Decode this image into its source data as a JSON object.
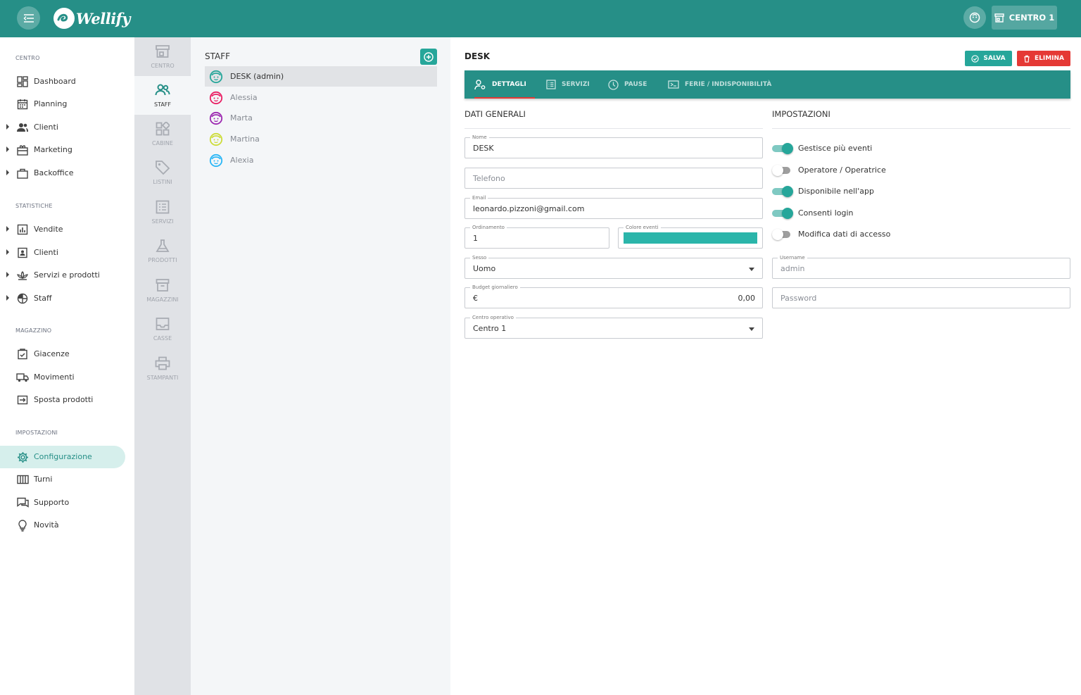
{
  "header": {
    "brand": "Wellify",
    "center_button_label": "CENTRO 1"
  },
  "sidebar": {
    "sections": [
      {
        "title": "CENTRO",
        "items": [
          {
            "label": "Dashboard",
            "icon": "dashboard-icon",
            "expandable": false
          },
          {
            "label": "Planning",
            "icon": "calendar-icon",
            "expandable": false
          },
          {
            "label": "Clienti",
            "icon": "users-icon",
            "expandable": true
          },
          {
            "label": "Marketing",
            "icon": "marketing-icon",
            "expandable": true
          },
          {
            "label": "Backoffice",
            "icon": "briefcase-icon",
            "expandable": true
          }
        ]
      },
      {
        "title": "STATISTICHE",
        "items": [
          {
            "label": "Vendite",
            "icon": "bar-chart-icon",
            "expandable": true
          },
          {
            "label": "Clienti",
            "icon": "contact-card-icon",
            "expandable": true
          },
          {
            "label": "Servizi e prodotti",
            "icon": "lotus-icon",
            "expandable": true
          },
          {
            "label": "Staff",
            "icon": "pie-chart-icon",
            "expandable": true
          }
        ]
      },
      {
        "title": "MAGAZZINO",
        "items": [
          {
            "label": "Giacenze",
            "icon": "clipboard-check-icon",
            "expandable": false
          },
          {
            "label": "Movimenti",
            "icon": "truck-icon",
            "expandable": false
          },
          {
            "label": "Sposta prodotti",
            "icon": "transfer-icon",
            "expandable": false
          }
        ]
      },
      {
        "title": "IMPOSTAZIONI",
        "items": [
          {
            "label": "Configurazione",
            "icon": "gear-icon",
            "expandable": false,
            "active": true
          },
          {
            "label": "Turni",
            "icon": "columns-icon",
            "expandable": false
          },
          {
            "label": "Supporto",
            "icon": "chat-icon",
            "expandable": false
          },
          {
            "label": "Novità",
            "icon": "lightbulb-icon",
            "expandable": false
          }
        ]
      }
    ]
  },
  "rail": {
    "items": [
      {
        "label": "CENTRO",
        "icon": "store-icon"
      },
      {
        "label": "STAFF",
        "icon": "staff-icon",
        "active": true
      },
      {
        "label": "CABINE",
        "icon": "grid-icon"
      },
      {
        "label": "LISTINI",
        "icon": "tag-icon"
      },
      {
        "label": "SERVIZI",
        "icon": "list-icon"
      },
      {
        "label": "PRODOTTI",
        "icon": "flask-icon"
      },
      {
        "label": "MAGAZZINI",
        "icon": "archive-icon"
      },
      {
        "label": "CASSE",
        "icon": "inbox-icon"
      },
      {
        "label": "STAMPANTI",
        "icon": "printer-icon"
      }
    ]
  },
  "staff_list": {
    "title": "STAFF",
    "items": [
      {
        "name": "DESK (admin)",
        "avatar_color": "#26a69a",
        "active": true
      },
      {
        "name": "Alessia",
        "avatar_color": "#e91e63"
      },
      {
        "name": "Marta",
        "avatar_color": "#9c27b0"
      },
      {
        "name": "Martina",
        "avatar_color": "#cddc39"
      },
      {
        "name": "Alexia",
        "avatar_color": "#29b6f6"
      }
    ]
  },
  "detail": {
    "title": "DESK",
    "save_label": "SALVA",
    "delete_label": "ELIMINA",
    "tabs": [
      {
        "label": "DETTAGLI",
        "icon": "user-settings-icon",
        "active": true
      },
      {
        "label": "SERVIZI",
        "icon": "list-icon"
      },
      {
        "label": "PAUSE",
        "icon": "clock-icon"
      },
      {
        "label": "FERIE / INDISPONIBILITÀ",
        "icon": "ticket-icon"
      }
    ],
    "general": {
      "title": "DATI GENERALI",
      "nome_label": "Nome",
      "nome_value": "DESK",
      "telefono_placeholder": "Telefono",
      "email_label": "Email",
      "email_value": "leonardo.pizzoni@gmail.com",
      "ordinamento_label": "Ordinamento",
      "ordinamento_value": "1",
      "colore_label": "Colore eventi",
      "colore_value": "#2bb5aa",
      "sesso_label": "Sesso",
      "sesso_value": "Uomo",
      "budget_label": "Budget giornaliero",
      "budget_currency": "€",
      "budget_value": "0,00",
      "centro_label": "Centro operativo",
      "centro_value": "Centro 1"
    },
    "settings": {
      "title": "IMPOSTAZIONI",
      "toggles": [
        {
          "label": "Gestisce più eventi",
          "on": true
        },
        {
          "label": "Operatore / Operatrice",
          "on": false
        },
        {
          "label": "Disponibile nell'app",
          "on": true
        },
        {
          "label": "Consenti login",
          "on": true
        },
        {
          "label": "Modifica dati di accesso",
          "on": false
        }
      ],
      "username_label": "Username",
      "username_value": "admin",
      "password_placeholder": "Password"
    }
  }
}
